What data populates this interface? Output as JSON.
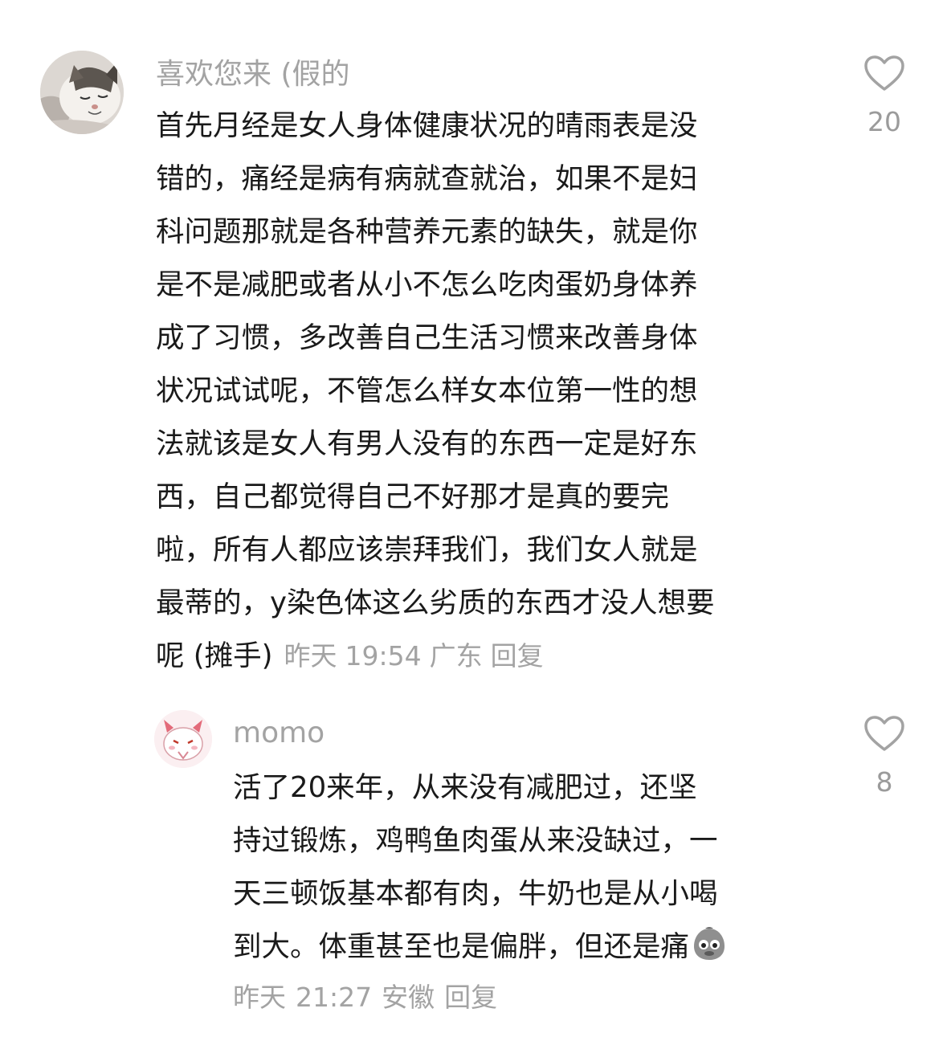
{
  "comments": [
    {
      "username": "喜欢您来 (假的",
      "avatar": "cat-avatar",
      "text_lines": [
        "首先月经是女人身体健康状况的晴雨表是没",
        "错的，痛经是病有病就查就治，如果不是妇",
        "科问题那就是各种营养元素的缺失，就是你",
        "是不是减肥或者从小不怎么吃肉蛋奶身体养",
        "成了习惯，多改善自己生活习惯来改善身体",
        "状况试试呢，不管怎么样女本位第一性的想",
        "法就该是女人有男人没有的东西一定是好东",
        "西，自己都觉得自己不好那才是真的要完",
        "啦，所有人都应该崇拜我们，我们女人就是",
        "最蒂的，y染色体这么劣质的东西才没人想要",
        "呢 (摊手)"
      ],
      "date": "昨天",
      "time": "19:54",
      "location": "广东",
      "reply_label": "回复",
      "likes": "20"
    },
    {
      "username": "momo",
      "avatar": "cartoon-avatar",
      "text_lines": [
        "活了20来年，从来没有减肥过，还坚",
        "持过锻炼，鸡鸭鱼肉蛋从来没缺过，一",
        "天三顿饭基本都有肉，牛奶也是从小喝",
        "到大。体重甚至也是偏胖，但还是痛"
      ],
      "date": "昨天",
      "time": "21:27",
      "location": "安徽",
      "reply_label": "回复",
      "likes": "8"
    }
  ],
  "icons": {
    "like": "heart-outline-icon",
    "emoji": "worried-face-emoji"
  },
  "colors": {
    "text": "#1a1a1a",
    "secondary": "#a3a3a3",
    "background": "#ffffff"
  }
}
